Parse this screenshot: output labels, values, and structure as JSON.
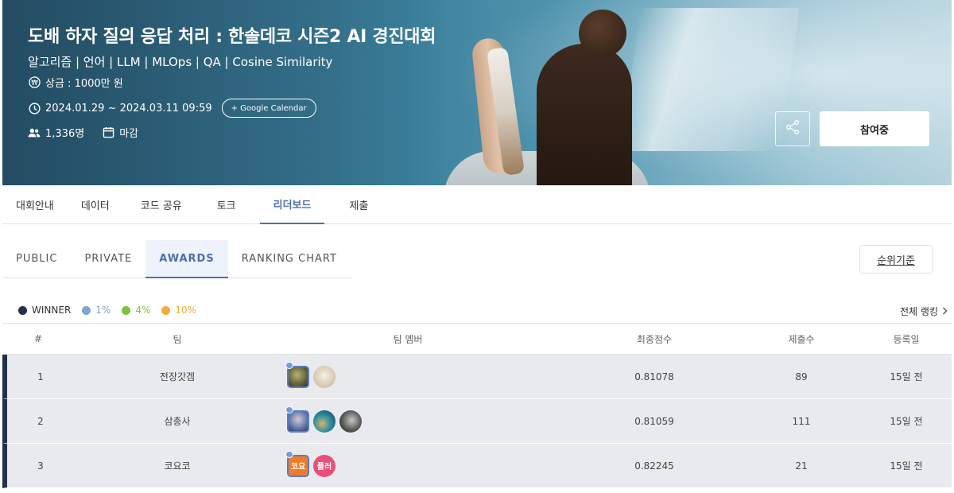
{
  "banner": {
    "title": "도배 하자 질의 응답 처리 : 한솔데코 시즌2 AI 경진대회",
    "subtitle": "알고리즘 | 언어 | LLM | MLOps | QA | Cosine Similarity",
    "prize": "상금 : 1000만 원",
    "period": "2024.01.29 ~ 2024.03.11 09:59",
    "google_calendar_label": "+ Google Calendar",
    "participants": "1,336명",
    "status": "마감",
    "join_label": "참여중"
  },
  "main_tabs": [
    {
      "label": "대회안내"
    },
    {
      "label": "데이터"
    },
    {
      "label": "코드 공유"
    },
    {
      "label": "토크"
    },
    {
      "label": "리더보드",
      "active": true
    },
    {
      "label": "제출"
    }
  ],
  "sub_tabs": [
    {
      "label": "PUBLIC"
    },
    {
      "label": "PRIVATE"
    },
    {
      "label": "AWARDS",
      "active": true
    },
    {
      "label": "RANKING CHART"
    }
  ],
  "criteria_label": "순위기준",
  "legend": [
    {
      "label": "WINNER",
      "color": "#23304a"
    },
    {
      "label": "1%",
      "color": "#7fa5cf"
    },
    {
      "label": "4%",
      "color": "#7cc242"
    },
    {
      "label": "10%",
      "color": "#f0ac3c"
    }
  ],
  "full_ranking_label": "전체 랭킹",
  "table": {
    "headers": {
      "rank": "#",
      "team": "팀",
      "members": "팀 멤버",
      "score": "최종점수",
      "submissions": "제출수",
      "date": "등록일"
    },
    "rows": [
      {
        "rank": "1",
        "team": "전장갓겜",
        "score": "0.81078",
        "submissions": "89",
        "date": "15일 전",
        "members": [
          {
            "icon": "avatar-dragon-icon",
            "leader": true
          },
          {
            "icon": "avatar-cat-icon"
          }
        ]
      },
      {
        "rank": "2",
        "team": "삼총사",
        "score": "0.81059",
        "submissions": "111",
        "date": "15일 전",
        "members": [
          {
            "icon": "avatar-portrait-icon",
            "leader": true
          },
          {
            "icon": "avatar-planet-icon"
          },
          {
            "icon": "avatar-photo-icon"
          }
        ]
      },
      {
        "rank": "3",
        "team": "코요코",
        "score": "0.82245",
        "submissions": "21",
        "date": "15일 전",
        "members": [
          {
            "text": "코요",
            "leader": true
          },
          {
            "text": "플러"
          }
        ]
      }
    ]
  }
}
